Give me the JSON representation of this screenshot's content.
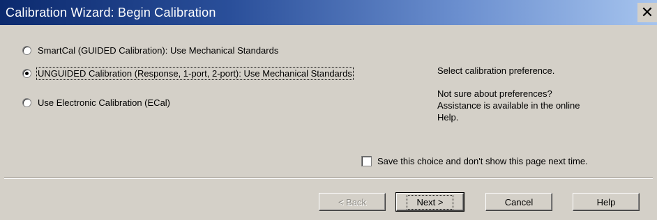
{
  "window": {
    "title": "Calibration Wizard: Begin Calibration",
    "close_label": "✕",
    "titlebar_colors": [
      "#0c2a6e",
      "#a6c4ee"
    ]
  },
  "options": [
    {
      "label": "SmartCal (GUIDED Calibration): Use Mechanical Standards",
      "selected": false
    },
    {
      "label": "UNGUIDED Calibration (Response, 1-port, 2-port): Use Mechanical Standards",
      "selected": true
    },
    {
      "label": "Use Electronic Calibration (ECal)",
      "selected": false
    }
  ],
  "help": {
    "line1": "Select calibration preference.",
    "line2": "Not sure about preferences?",
    "line3": "Assistance is available in the online",
    "line4": "Help."
  },
  "save_choice": {
    "label": "Save this choice and don't show this page next time.",
    "checked": false
  },
  "buttons": {
    "back": "< Back",
    "next": "Next >",
    "cancel": "Cancel",
    "help": "Help"
  }
}
